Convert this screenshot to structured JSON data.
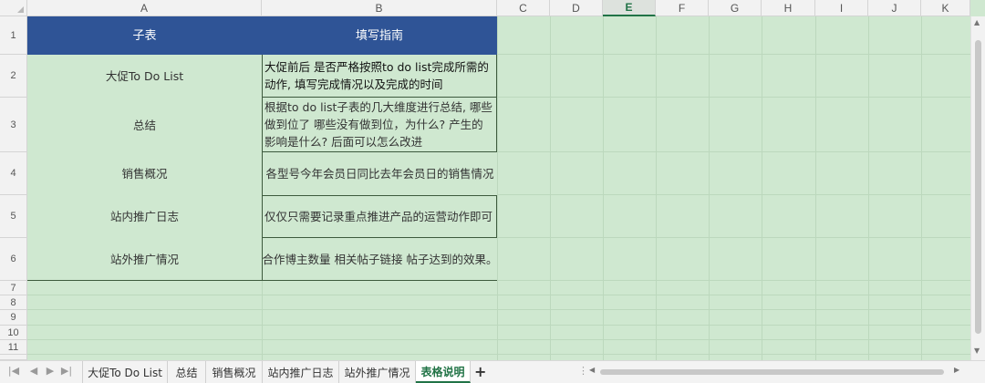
{
  "columns": [
    "A",
    "B",
    "C",
    "D",
    "E",
    "F",
    "G",
    "H",
    "I",
    "J",
    "K"
  ],
  "rows": [
    "1",
    "2",
    "3",
    "4",
    "5",
    "6",
    "7",
    "8",
    "9",
    "10",
    "11"
  ],
  "selected_column": "E",
  "table": {
    "header": [
      "子表",
      "填写指南"
    ],
    "rows": [
      {
        "name": "大促To Do List",
        "guide": "大促前后 是否严格按照to do list完成所需的动作, 填写完成情况以及完成的时间"
      },
      {
        "name": "总结",
        "guide": "根据to do list子表的几大维度进行总结, 哪些做到位了 哪些没有做到位，为什么? 产生的影响是什么? 后面可以怎么改进"
      },
      {
        "name": "销售概况",
        "guide": "各型号今年会员日同比去年会员日的销售情况"
      },
      {
        "name": "站内推广日志",
        "guide": "仅仅只需要记录重点推进产品的运营动作即可"
      },
      {
        "name": "站外推广情况",
        "guide": "合作博主数量 相关帖子链接 帖子达到的效果。"
      }
    ]
  },
  "sheet_tabs": [
    "大促To Do List",
    "总结",
    "销售概况",
    "站内推广日志",
    "站外推广情况",
    "表格说明"
  ],
  "active_tab": "表格说明",
  "add_tab_label": "+",
  "nav_glyphs": {
    "first": "|◀",
    "prev": "◀",
    "next": "▶",
    "last": "▶|"
  },
  "colors": {
    "accent": "#217346",
    "header_fill": "#2f5496",
    "cell_fill": "#cfe8d0"
  }
}
